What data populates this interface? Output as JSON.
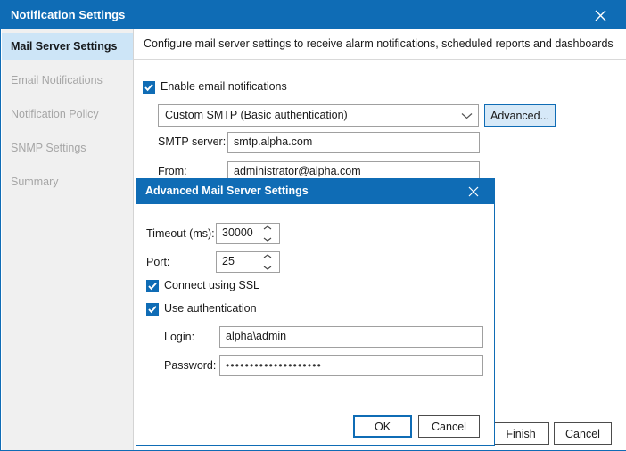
{
  "window": {
    "title": "Notification Settings",
    "close_icon": "close-icon"
  },
  "sidebar": {
    "items": [
      {
        "label": "Mail Server Settings",
        "active": true
      },
      {
        "label": "Email Notifications",
        "active": false
      },
      {
        "label": "Notification Policy",
        "active": false
      },
      {
        "label": "SNMP Settings",
        "active": false
      },
      {
        "label": "Summary",
        "active": false
      }
    ]
  },
  "main": {
    "header": "Configure mail server settings to receive alarm notifications, scheduled reports and dashboards",
    "enable_checkbox": {
      "label": "Enable email notifications",
      "checked": true
    },
    "smtp_mode": {
      "value": "Custom SMTP (Basic authentication)",
      "chevron_icon": "chevron-down-icon"
    },
    "advanced_button": "Advanced...",
    "fields": [
      {
        "label": "SMTP server:",
        "value": "smtp.alpha.com"
      },
      {
        "label": "From:",
        "value": "administrator@alpha.com"
      }
    ],
    "footer": {
      "finish": "Finish",
      "cancel": "Cancel"
    }
  },
  "modal": {
    "title": "Advanced Mail Server Settings",
    "close_icon": "close-icon",
    "timeout": {
      "label": "Timeout (ms):",
      "value": "30000"
    },
    "port": {
      "label": "Port:",
      "value": "25"
    },
    "ssl_checkbox": {
      "label": "Connect using SSL",
      "checked": true
    },
    "auth_checkbox": {
      "label": "Use authentication",
      "checked": true
    },
    "login": {
      "label": "Login:",
      "value": "alpha\\admin"
    },
    "password": {
      "label": "Password:",
      "value": "••••••••••••••••••••"
    },
    "buttons": {
      "ok": "OK",
      "cancel": "Cancel"
    }
  },
  "colors": {
    "accent": "#0f6cb5",
    "active_item": "#cde5f7",
    "sidebar_bg": "#f0f0f0",
    "advanced_btn_bg": "#d6e9f8"
  }
}
